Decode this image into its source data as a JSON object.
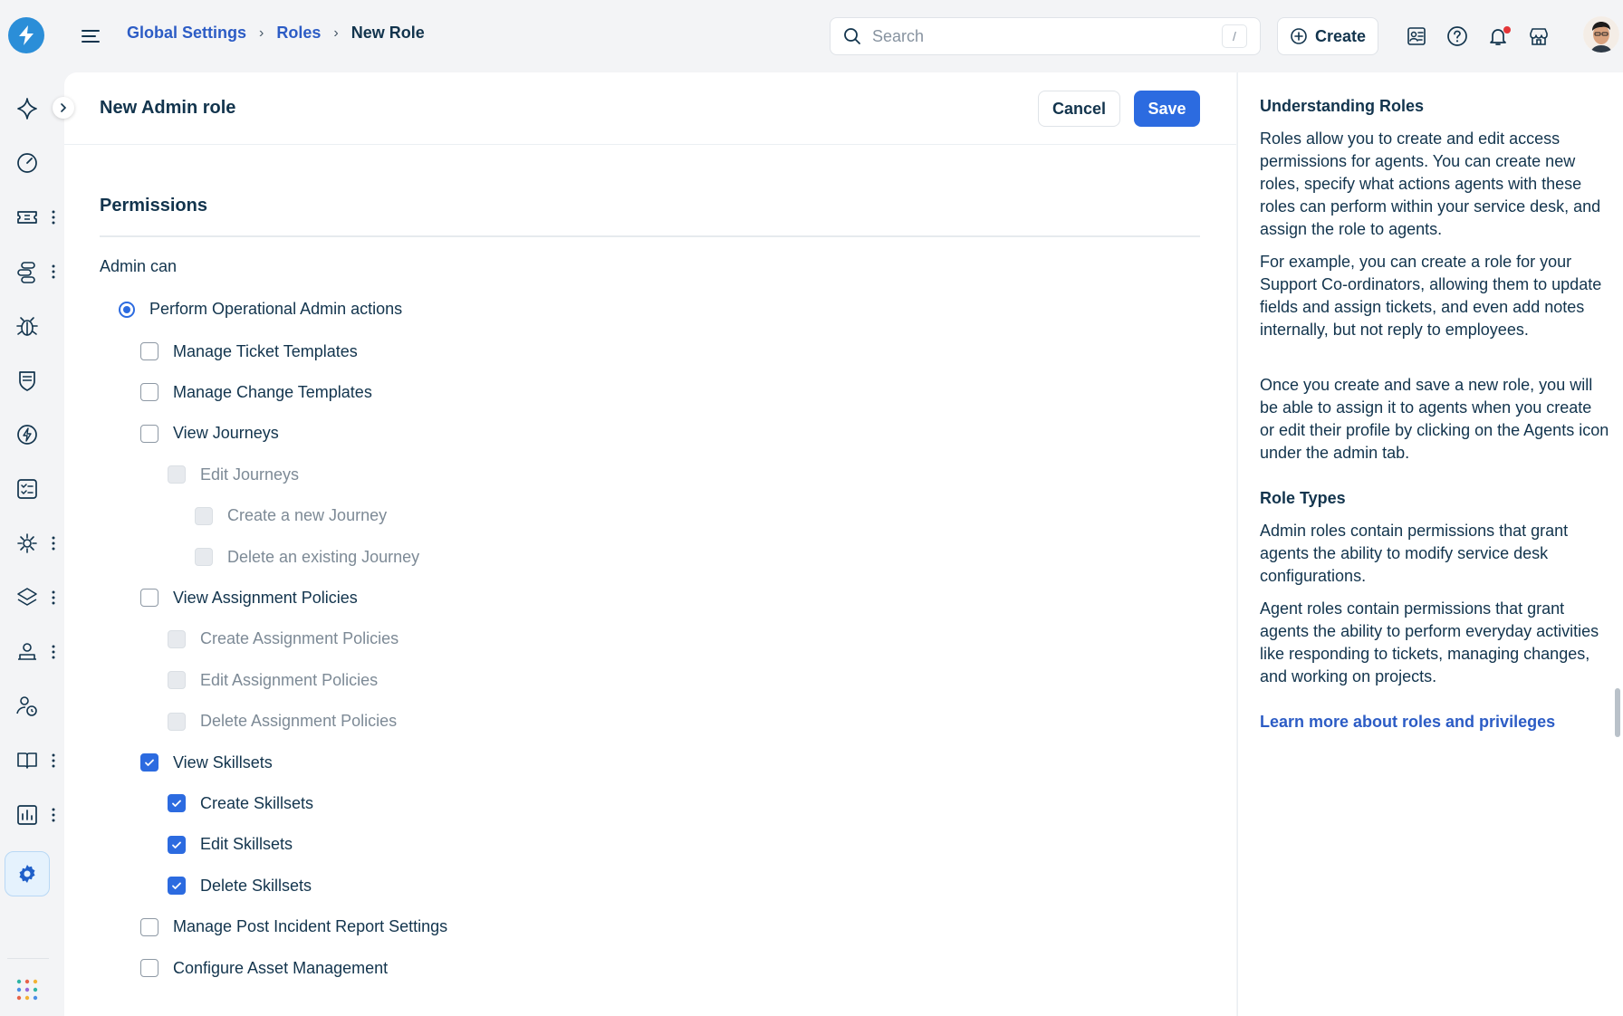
{
  "breadcrumb": {
    "item1": "Global Settings",
    "item2": "Roles",
    "current": "New Role"
  },
  "search": {
    "placeholder": "Search",
    "shortcut": "/"
  },
  "header": {
    "create_label": "Create"
  },
  "page": {
    "title": "New Admin role",
    "cancel_label": "Cancel",
    "save_label": "Save"
  },
  "permissions": {
    "section_title": "Permissions",
    "admin_can_label": "Admin can",
    "radio_label": "Perform Operational Admin actions",
    "items": [
      {
        "label": "Manage Ticket Templates",
        "checked": false,
        "disabled": false
      },
      {
        "label": "Manage Change Templates",
        "checked": false,
        "disabled": false
      },
      {
        "label": "View Journeys",
        "checked": false,
        "disabled": false
      },
      {
        "label": "Edit Journeys",
        "checked": false,
        "disabled": true
      },
      {
        "label": "Create a new Journey",
        "checked": false,
        "disabled": true
      },
      {
        "label": "Delete an existing Journey",
        "checked": false,
        "disabled": true
      },
      {
        "label": "View Assignment Policies",
        "checked": false,
        "disabled": false
      },
      {
        "label": "Create Assignment Policies",
        "checked": false,
        "disabled": true
      },
      {
        "label": "Edit Assignment Policies",
        "checked": false,
        "disabled": true
      },
      {
        "label": "Delete Assignment Policies",
        "checked": false,
        "disabled": true
      },
      {
        "label": "View Skillsets",
        "checked": true,
        "disabled": false
      },
      {
        "label": "Create Skillsets",
        "checked": true,
        "disabled": false
      },
      {
        "label": "Edit Skillsets",
        "checked": true,
        "disabled": false
      },
      {
        "label": "Delete Skillsets",
        "checked": true,
        "disabled": false
      },
      {
        "label": "Manage Post Incident Report Settings",
        "checked": false,
        "disabled": false
      },
      {
        "label": "Configure Asset Management",
        "checked": false,
        "disabled": false
      }
    ]
  },
  "side_panel": {
    "heading1": "Understanding Roles",
    "para1": "Roles allow you to create and edit access permissions for agents. You can create new roles, specify what actions agents with these roles can perform within your service desk, and assign the role to agents.",
    "para2": "For example, you can create a role for your Support Co-ordinators, allowing them to update fields and assign tickets, and even add notes internally, but not reply to employees.",
    "para3": "Once you create and save a new role, you will be able to assign it to agents when you create or edit their profile by clicking on the Agents icon under the admin tab.",
    "heading2": "Role Types",
    "para4": "Admin roles contain permissions that grant agents the ability to modify service desk configurations.",
    "para5": "Agent roles contain permissions that grant agents the ability to perform everyday activities like responding to tickets, managing changes, and working on projects.",
    "link": "Learn more about roles and privileges"
  },
  "colors": {
    "accent": "#2c6be0",
    "link": "#2c5cc5",
    "text": "#12344d",
    "logo": "#2b8ed8"
  }
}
